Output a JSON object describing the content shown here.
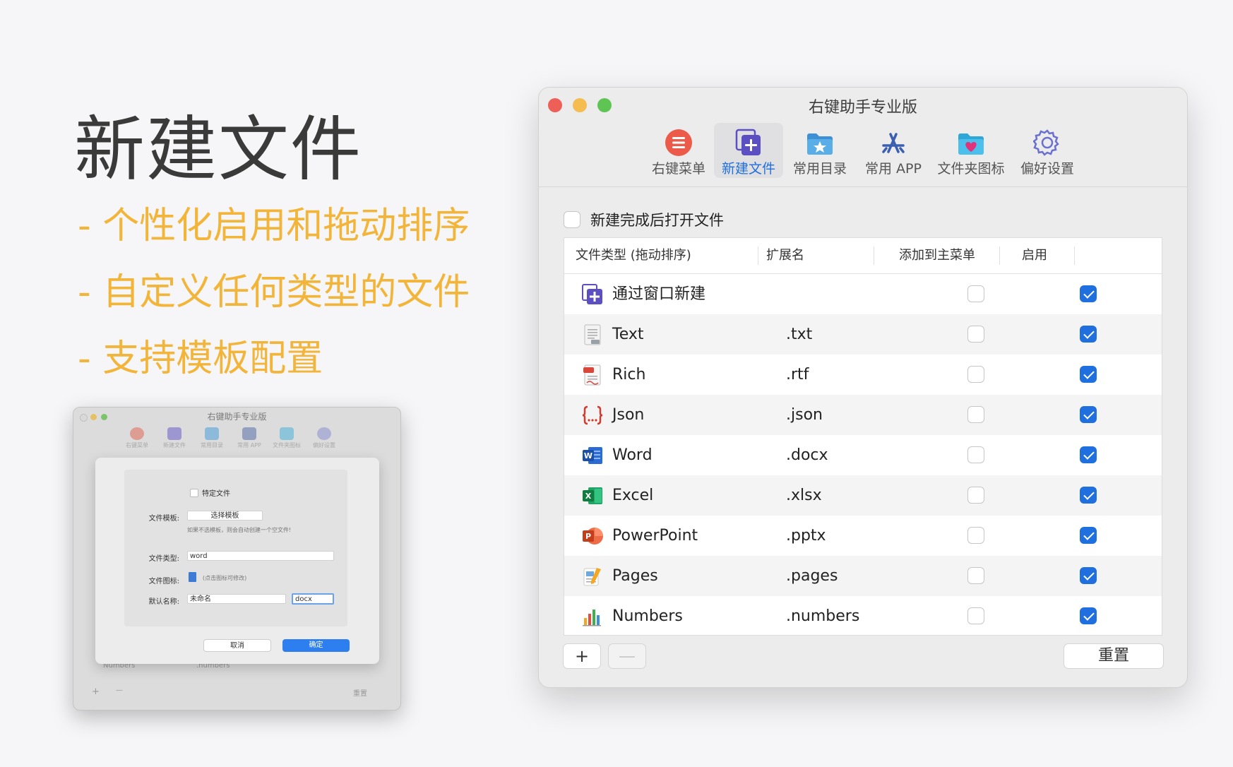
{
  "promo": {
    "title": "新建文件",
    "bullets": [
      "- 个性化启用和拖动排序",
      "- 自定义任何类型的文件",
      "- 支持模板配置"
    ]
  },
  "mini_window": {
    "title": "右键助手专业版",
    "toolbar": [
      "右键菜单",
      "新建文件",
      "常用目录",
      "常用 APP",
      "文件夹图标",
      "偏好设置"
    ],
    "specific_file_label": "特定文件",
    "template_label": "文件模板:",
    "template_button": "选择模板",
    "template_hint": "如果不选模板，则会自动创建一个空文件!",
    "type_label": "文件类型:",
    "type_value": "word",
    "icon_label": "文件图标:",
    "icon_hint": "(点击图标可修改)",
    "default_name_label": "默认名称:",
    "default_name_value": "未命名",
    "ext_value": "docx",
    "cancel": "取消",
    "confirm": "确定",
    "bg_row_name": "Numbers",
    "bg_row_ext": ".numbers",
    "bg_plus": "+",
    "bg_minus": "—",
    "bg_reset": "重置"
  },
  "window": {
    "title": "右键助手专业版",
    "toolbar": [
      {
        "label": "右键菜单",
        "icon": "menu-icon"
      },
      {
        "label": "新建文件",
        "icon": "new-file-icon",
        "active": true
      },
      {
        "label": "常用目录",
        "icon": "folder-star-icon"
      },
      {
        "label": "常用 APP",
        "icon": "app-store-icon"
      },
      {
        "label": "文件夹图标",
        "icon": "folder-heart-icon"
      },
      {
        "label": "偏好设置",
        "icon": "gear-icon"
      }
    ],
    "open_after_create": {
      "label": "新建完成后打开文件",
      "checked": false
    },
    "columns": [
      "文件类型 (拖动排序)",
      "扩展名",
      "添加到主菜单",
      "启用"
    ],
    "rows": [
      {
        "name": "通过窗口新建",
        "ext": "",
        "main_menu": false,
        "enabled": true,
        "icon": "window-new-icon"
      },
      {
        "name": "Text",
        "ext": ".txt",
        "main_menu": false,
        "enabled": true,
        "icon": "text-file-icon"
      },
      {
        "name": "Rich",
        "ext": ".rtf",
        "main_menu": false,
        "enabled": true,
        "icon": "rtf-file-icon"
      },
      {
        "name": "Json",
        "ext": ".json",
        "main_menu": false,
        "enabled": true,
        "icon": "json-file-icon"
      },
      {
        "name": "Word",
        "ext": ".docx",
        "main_menu": false,
        "enabled": true,
        "icon": "word-icon"
      },
      {
        "name": "Excel",
        "ext": ".xlsx",
        "main_menu": false,
        "enabled": true,
        "icon": "excel-icon"
      },
      {
        "name": "PowerPoint",
        "ext": ".pptx",
        "main_menu": false,
        "enabled": true,
        "icon": "powerpoint-icon"
      },
      {
        "name": "Pages",
        "ext": ".pages",
        "main_menu": false,
        "enabled": true,
        "icon": "pages-icon"
      },
      {
        "name": "Numbers",
        "ext": ".numbers",
        "main_menu": false,
        "enabled": true,
        "icon": "numbers-icon"
      }
    ],
    "add_button": "+",
    "remove_button": "—",
    "reset_button": "重置",
    "accent_color": "#1f6fde"
  }
}
